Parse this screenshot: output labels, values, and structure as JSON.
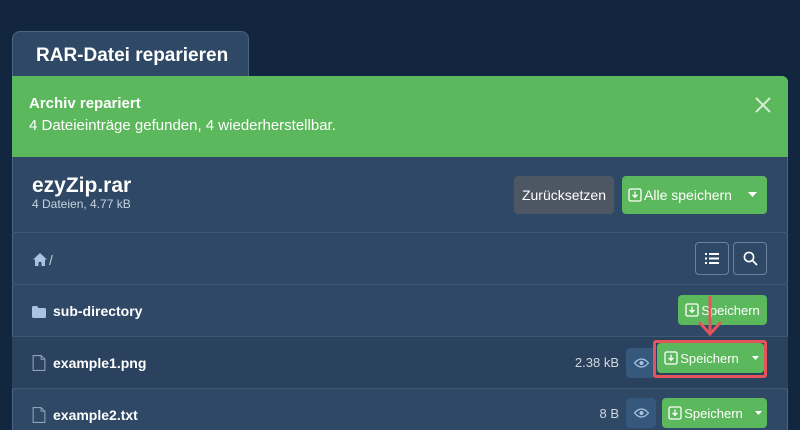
{
  "tab": {
    "title": "RAR-Datei reparieren"
  },
  "alert": {
    "title": "Archiv repariert",
    "text": "4 Dateieinträge gefunden, 4 wiederherstellbar."
  },
  "archive": {
    "name": "ezyZip.rar",
    "meta": "4 Dateien, 4.77 kB",
    "reset_label": "Zurücksetzen",
    "save_all_label": "Alle speichern"
  },
  "breadcrumb": {
    "separator": "/"
  },
  "rows": [
    {
      "name": "sub-directory",
      "type": "folder",
      "save_label": "Speichern"
    },
    {
      "name": "example1.png",
      "type": "file",
      "size": "2.38 kB",
      "save_label": "Speichern"
    },
    {
      "name": "example2.txt",
      "type": "file",
      "size": "8 B",
      "save_label": "Speichern"
    }
  ],
  "colors": {
    "background": "#132640",
    "panel": "#2e4865",
    "success": "#5cb85c",
    "highlight": "#e3555b"
  },
  "icons": [
    "close-icon",
    "download-icon",
    "caret-down-icon",
    "home-icon",
    "list-icon",
    "search-icon",
    "folder-icon",
    "file-icon",
    "eye-icon",
    "arrow-down-icon"
  ]
}
